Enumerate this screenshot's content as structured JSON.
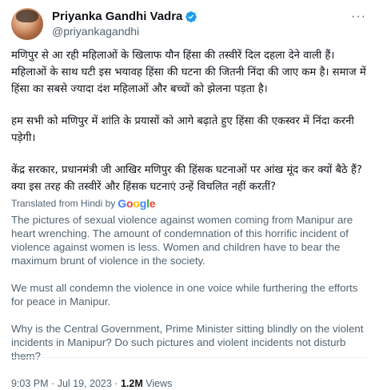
{
  "author": {
    "name": "Priyanka Gandhi Vadra",
    "handle": "@priyankagandhi",
    "verified_icon": "verified-badge-icon",
    "verified_color": "#1d9bf0"
  },
  "more_menu": {
    "icon": "more-options-icon",
    "label": "···"
  },
  "tweet": {
    "hindi_paragraphs": [
      "मणिपुर से आ रही महिलाओं के खिलाफ यौन हिंसा की तस्वीरें दिल दहला देने वाली हैं। महिलाओं के साथ घटी इस भयावह हिंसा की घटना की जितनी निंदा की जाए कम है। समाज में हिंसा का सबसे ज्यादा दंश महिलाओं और बच्चों को झेलना पड़ता है।",
      "हम सभी को मणिपुर में शांति के प्रयासों को आगे बढ़ाते हुए हिंसा की एकस्वर में निंदा करनी पड़ेगी।",
      "केंद्र सरकार, प्रधानमंत्री जी आखिर मणिपुर की हिंसक घटनाओं पर आंख मूंद कर क्यों बैठे हैं? क्या इस तरह की तस्वीरें और हिंसक घटनाएं उन्हें विचलित नहीं करतीं?"
    ],
    "translated_label": "Translated from Hindi by",
    "translator": "Google",
    "google_colors": [
      "#4285F4",
      "#EA4335",
      "#FBBC05",
      "#4285F4",
      "#34A853",
      "#EA4335"
    ],
    "english_paragraphs": [
      "The pictures of sexual violence against women coming from Manipur are heart wrenching. The amount of condemnation of this horrific incident of violence against women is less. Women and children have to bear the maximum brunt of violence in the society.",
      "We must all condemn the violence in one voice while furthering the efforts for peace in Manipur.",
      "Why is the Central Government, Prime Minister sitting blindly on the violent incidents in Manipur? Do such pictures and violent incidents not disturb them?"
    ]
  },
  "meta": {
    "time": "9:03 PM",
    "separator": "·",
    "date": "Jul 19, 2023",
    "views_count": "1.2M",
    "views_label": "Views"
  }
}
